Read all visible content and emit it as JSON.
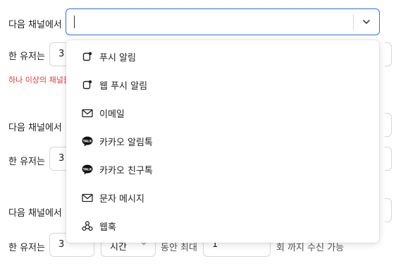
{
  "rows": [
    {
      "channel_label": "다음 채널에서",
      "user_label": "한 유저는",
      "count_value": "3",
      "error_text": "하나 이상의 채널을"
    },
    {
      "channel_label": "다음 채널에서",
      "user_label": "한 유저는",
      "count_value": "3"
    },
    {
      "channel_label": "다음 채널에서",
      "user_label": "한 유저는",
      "count_value": "3",
      "unit_value": "시간",
      "middle_text": "동안 최대",
      "max_value": "1",
      "tail_text": "회 까지 수신 가능"
    }
  ],
  "channel_select": {
    "value": ""
  },
  "menu": {
    "items": [
      {
        "label": "푸시 알림",
        "icon": "push-icon"
      },
      {
        "label": "웹 푸시 알림",
        "icon": "push-icon"
      },
      {
        "label": "이메일",
        "icon": "mail-icon"
      },
      {
        "label": "카카오 알림톡",
        "icon": "talk-icon"
      },
      {
        "label": "카카오 친구톡",
        "icon": "talk-icon"
      },
      {
        "label": "문자 메시지",
        "icon": "mail-icon"
      },
      {
        "label": "웹훅",
        "icon": "webhook-icon"
      }
    ]
  },
  "colors": {
    "accent": "#2f6fe4",
    "error": "#e5383b",
    "border": "#d4d7dc"
  }
}
